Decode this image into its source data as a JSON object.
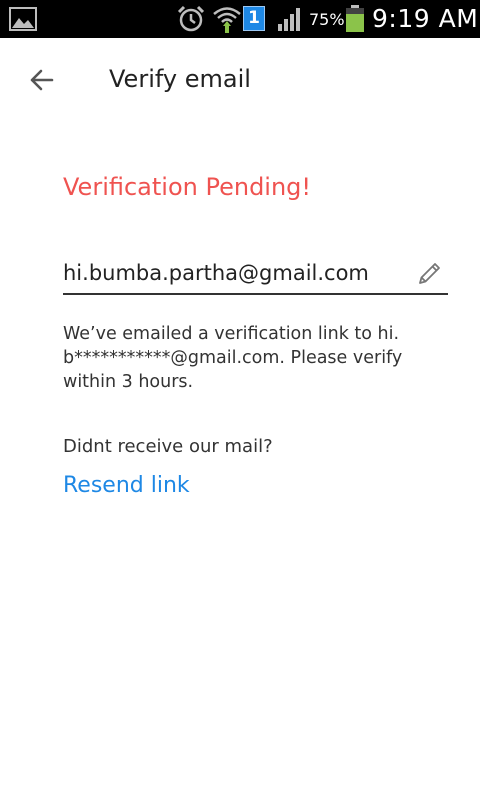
{
  "status_bar": {
    "icons": [
      "gallery-icon",
      "alarm-icon",
      "wifi-icon",
      "notification-count-icon",
      "signal-icon",
      "battery-icon"
    ],
    "notification_count": "1",
    "battery_percent": "75%",
    "battery_level": 0.75,
    "time": "9:19 AM"
  },
  "toolbar": {
    "back_icon": "arrow-back-icon",
    "title": "Verify email"
  },
  "main": {
    "status_title": "Verification Pending!",
    "email": {
      "value": "hi.bumba.partha@gmail.com",
      "edit_icon": "pencil-icon"
    },
    "info_lines": [
      "We’ve emailed a verification link to hi.",
      "b***********@gmail.com. Please verify",
      "within 3 hours."
    ],
    "resend_question": "Didnt receive our mail?",
    "resend_label": "Resend link"
  },
  "colors": {
    "status_bar_bg": "#000000",
    "pending_title": "#ef5350",
    "link": "#1e88e5",
    "notification_badge": "#1e88e5",
    "battery_fill": "#8bc34a"
  }
}
